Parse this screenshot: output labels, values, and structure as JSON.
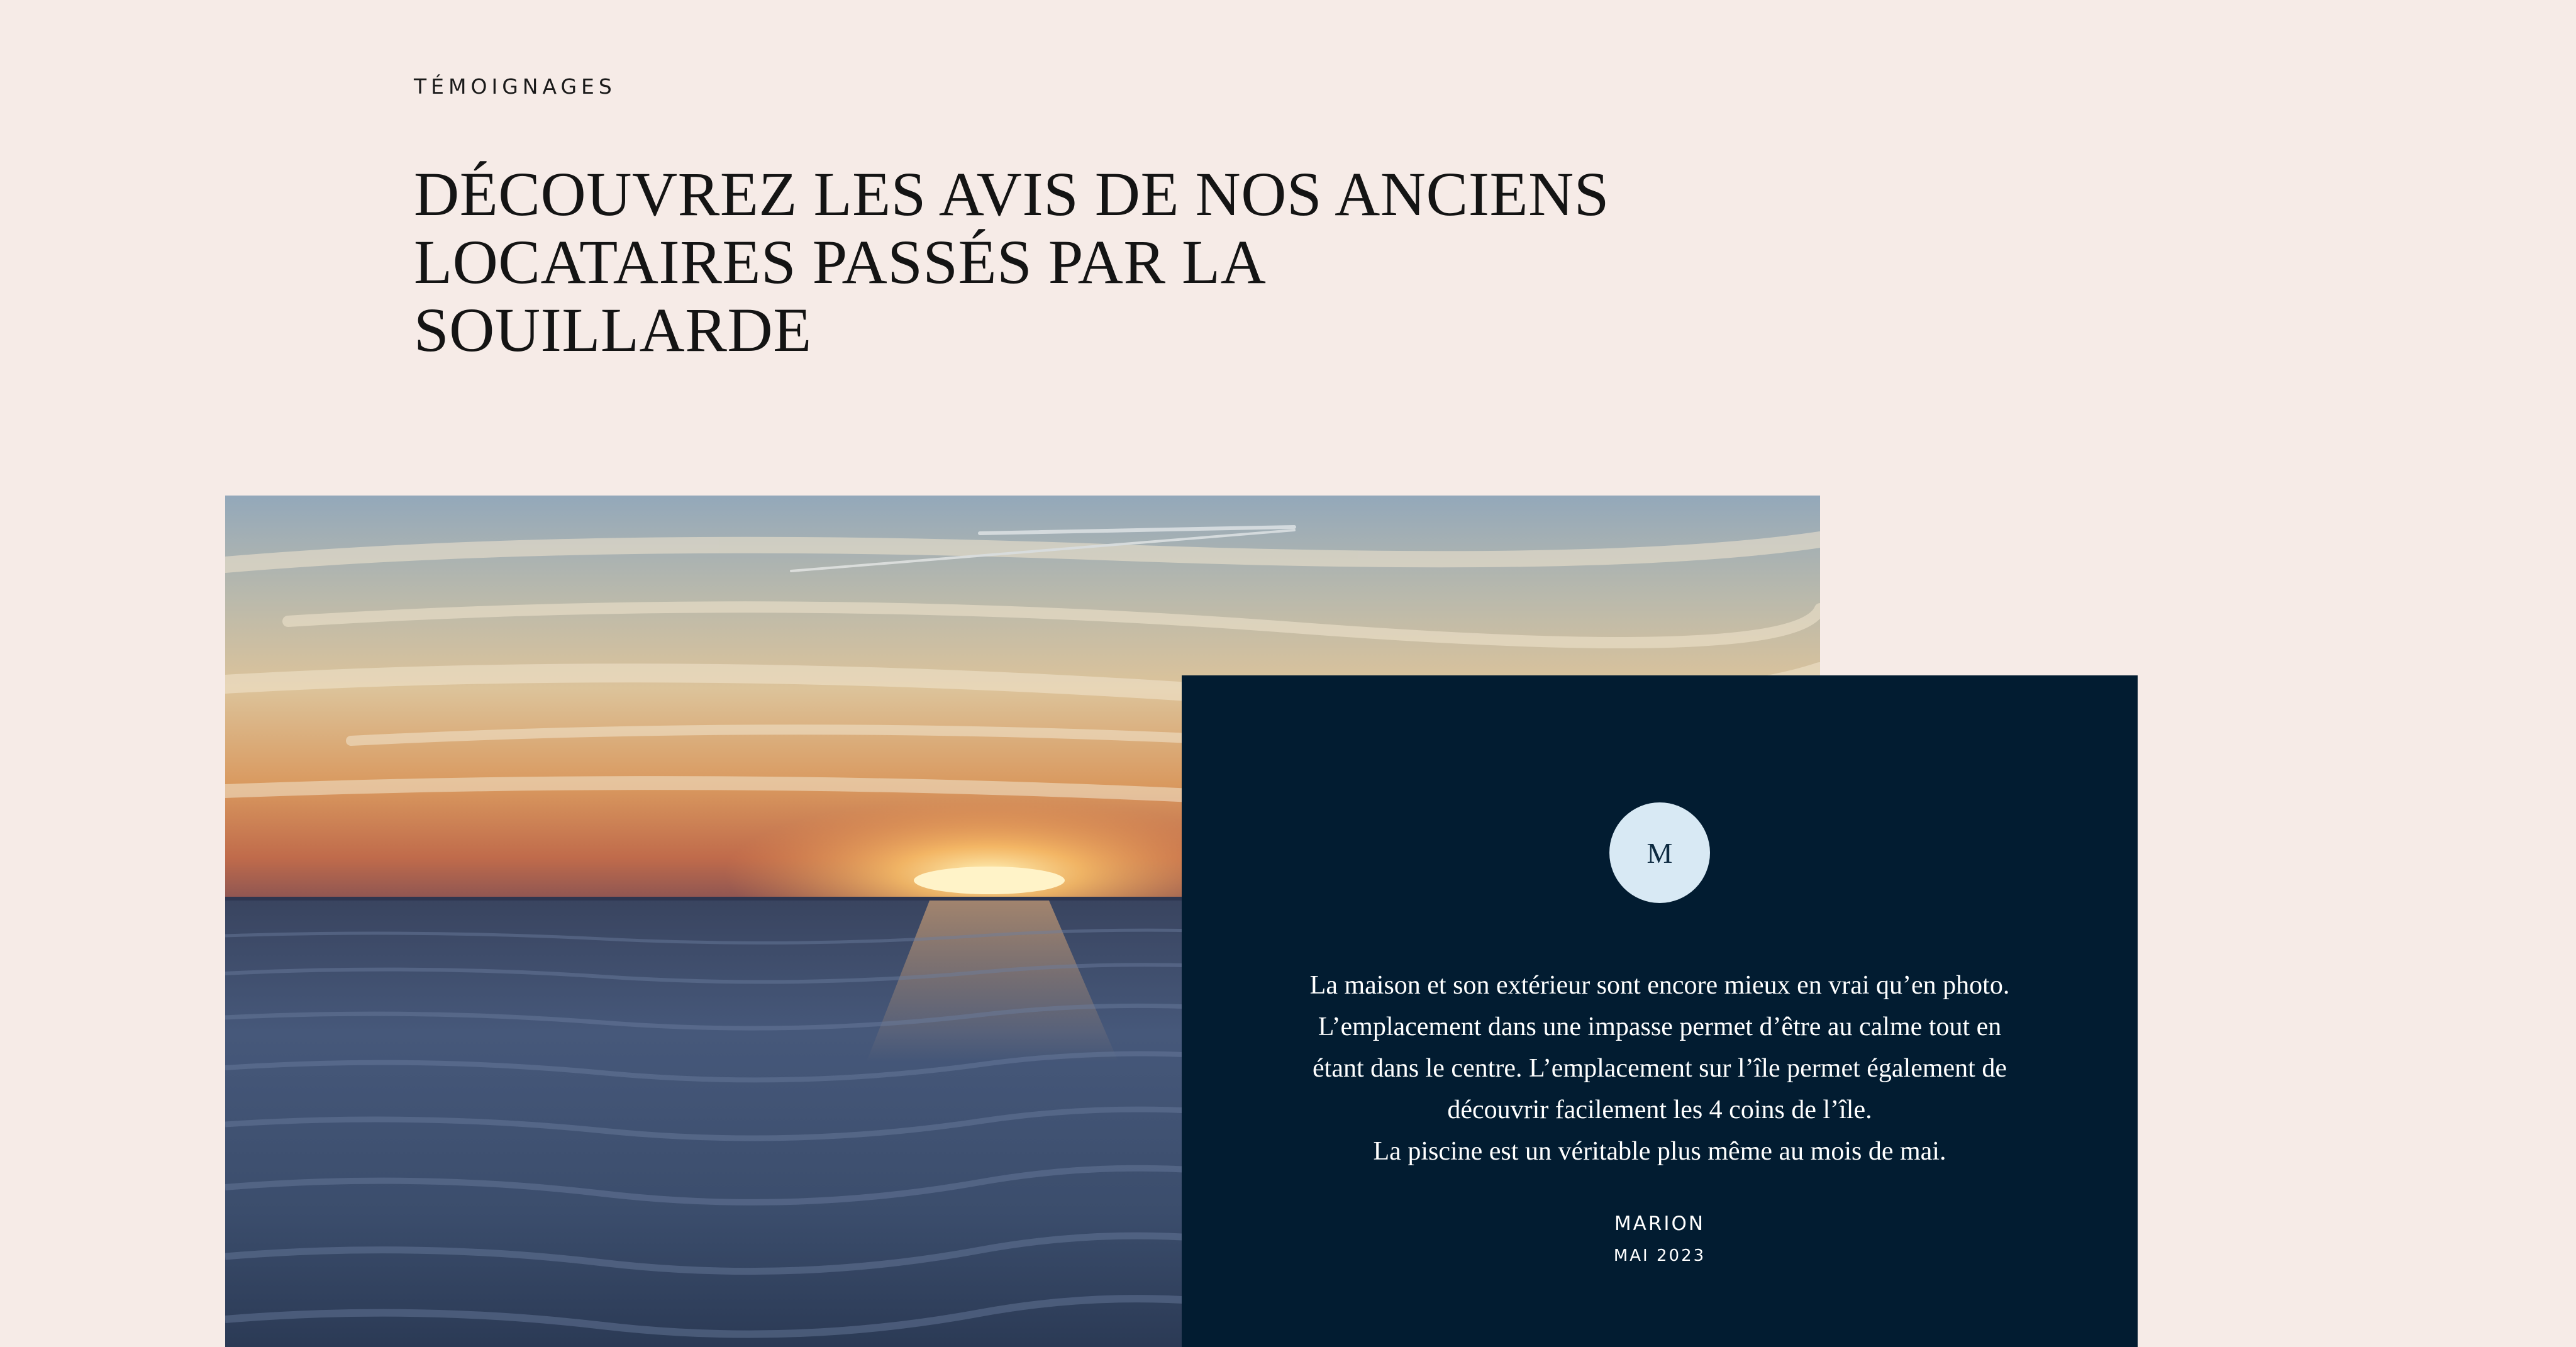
{
  "section": {
    "eyebrow": "TÉMOIGNAGES",
    "heading_lines": [
      "DÉCOUVREZ LES AVIS DE NOS ANCIENS",
      "LOCATAIRES PASSÉS PAR LA",
      "SOUILLARDE"
    ]
  },
  "photo": {
    "description_icon": "sunset-sea-photo"
  },
  "testimonial": {
    "avatar_initial": "M",
    "quote_lines": [
      "La maison et son extérieur sont encore mieux en vrai qu’en photo.",
      "L’emplacement dans une impasse permet d’être au calme tout en",
      "étant dans le centre. L’emplacement sur l’île permet également de",
      "découvrir facilement les 4 coins de l’île.",
      "La piscine est un véritable plus même au mois de mai."
    ],
    "author": "MARION",
    "date": "MAI 2023"
  },
  "colors": {
    "background": "#f6ebe7",
    "card": "#021c31",
    "avatar": "#d8e9f4"
  }
}
